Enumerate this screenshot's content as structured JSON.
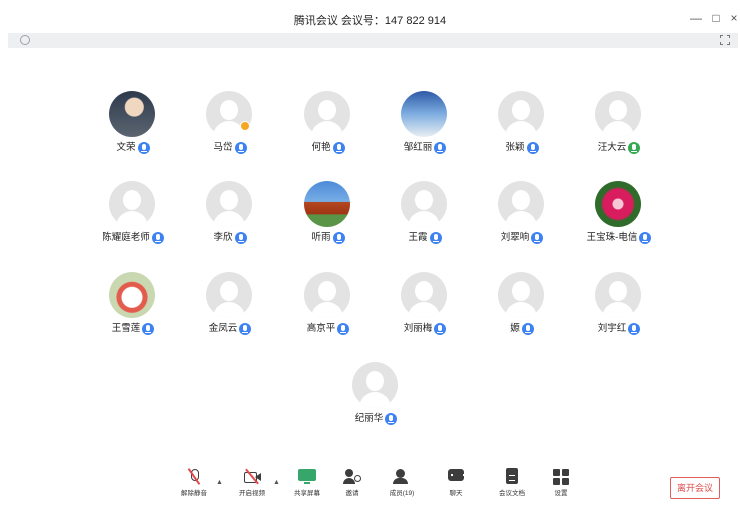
{
  "window": {
    "title": "腾讯会议 会议号：147 822 914",
    "controls": {
      "minimize": "—",
      "maximize": "□",
      "close": "×"
    }
  },
  "participants": [
    {
      "name": "文荣",
      "avatar": "photo-1",
      "mic": "blue"
    },
    {
      "name": "马岱",
      "avatar": "default",
      "mic": "blue",
      "badge": true
    },
    {
      "name": "何艳",
      "avatar": "default",
      "mic": "blue"
    },
    {
      "name": "邹红丽",
      "avatar": "photo-2",
      "mic": "blue"
    },
    {
      "name": "张颖",
      "avatar": "default",
      "mic": "blue"
    },
    {
      "name": "汪大云",
      "avatar": "default",
      "mic": "green"
    },
    {
      "name": "陈耀庭老师",
      "avatar": "default",
      "mic": "blue"
    },
    {
      "name": "李欣",
      "avatar": "default",
      "mic": "blue"
    },
    {
      "name": "听雨",
      "avatar": "photo-3",
      "mic": "blue"
    },
    {
      "name": "王霞",
      "avatar": "default",
      "mic": "blue"
    },
    {
      "name": "刘翠响",
      "avatar": "default",
      "mic": "blue"
    },
    {
      "name": "王宝珠-电信",
      "avatar": "photo-4",
      "mic": "blue"
    },
    {
      "name": "王雪莲",
      "avatar": "photo-5",
      "mic": "blue"
    },
    {
      "name": "金凤云",
      "avatar": "default",
      "mic": "blue"
    },
    {
      "name": "高京平",
      "avatar": "default",
      "mic": "blue"
    },
    {
      "name": "刘丽梅",
      "avatar": "default",
      "mic": "blue"
    },
    {
      "name": "嫄",
      "avatar": "default",
      "mic": "blue"
    },
    {
      "name": "刘宇红",
      "avatar": "default",
      "mic": "blue"
    },
    {
      "name": "纪丽华",
      "avatar": "default",
      "mic": "blue"
    }
  ],
  "toolbar": {
    "unmute": "解除静音",
    "video": "开启视频",
    "share": "共享屏幕",
    "invite": "邀请",
    "members": "成员(19)",
    "chat": "聊天",
    "docs": "会议文档",
    "settings": "设置",
    "leave": "离开会议"
  },
  "colors": {
    "accent": "#3d82f2",
    "danger": "#e14a4a",
    "share_green": "#36a66a"
  }
}
